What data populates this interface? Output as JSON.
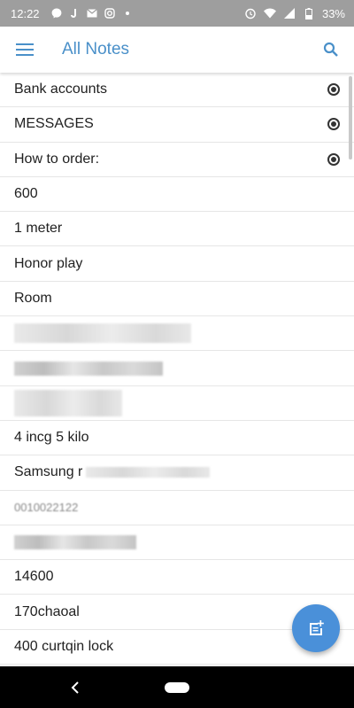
{
  "status_bar": {
    "time": "12:22",
    "battery": "33%",
    "icons": [
      "messenger-icon",
      "j-icon",
      "mail-icon",
      "instagram-icon",
      "dot-icon",
      "alarm-icon",
      "wifi-icon",
      "signal-icon",
      "battery-icon"
    ]
  },
  "app_bar": {
    "title": "All Notes",
    "accent_color": "#4a90c9"
  },
  "notes": [
    {
      "title": "Bank accounts",
      "pinned": true
    },
    {
      "title": "MESSAGES",
      "pinned": true
    },
    {
      "title": "How to order:",
      "pinned": true
    },
    {
      "title": "600",
      "pinned": false
    },
    {
      "title": "1 meter",
      "pinned": false
    },
    {
      "title": "Honor play",
      "pinned": false
    },
    {
      "title": "Room",
      "pinned": false
    },
    {
      "title": "",
      "pinned": false,
      "blurred": true
    },
    {
      "title": "",
      "pinned": false,
      "blurred": true
    },
    {
      "title": "",
      "pinned": false,
      "blurred": true
    },
    {
      "title": "4 incg 5 kilo",
      "pinned": false
    },
    {
      "title": "Samsung r",
      "pinned": false,
      "partially_blurred": true
    },
    {
      "title": "0010022122",
      "pinned": false,
      "partially_blurred": true
    },
    {
      "title": "",
      "pinned": false,
      "blurred": true
    },
    {
      "title": "14600",
      "pinned": false
    },
    {
      "title": "170chaoal",
      "pinned": false
    },
    {
      "title": "400 curtqin lock",
      "pinned": false
    }
  ],
  "fab": {
    "icon": "new-note-icon",
    "color": "#4a90d9"
  }
}
